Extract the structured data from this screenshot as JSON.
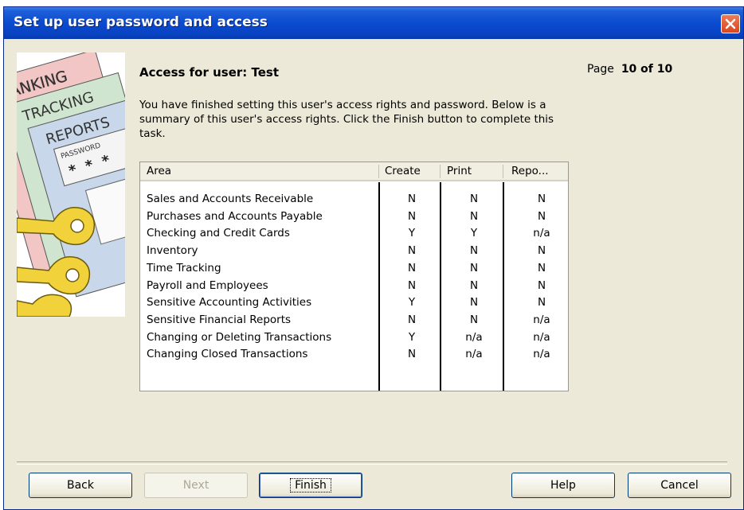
{
  "window": {
    "title": "Set up user password and access"
  },
  "heading": "Access for user: Test",
  "page": {
    "label": "Page",
    "value": "10 of 10"
  },
  "description": "You have finished setting this user's access rights and password. Below is a summary of this user's access rights.  Click the Finish button to complete this task.",
  "art": {
    "words": [
      "BANKING",
      "TRACKING",
      "REPORTS",
      "PASSWORD",
      "* * *"
    ]
  },
  "table": {
    "columns": [
      "Area",
      "Create",
      "Print",
      "Repo..."
    ],
    "rows": [
      [
        "Sales and Accounts Receivable",
        "N",
        "N",
        "N"
      ],
      [
        "Purchases and Accounts Payable",
        "N",
        "N",
        "N"
      ],
      [
        "Checking and Credit Cards",
        "Y",
        "Y",
        "n/a"
      ],
      [
        "Inventory",
        "N",
        "N",
        "N"
      ],
      [
        "Time Tracking",
        "N",
        "N",
        "N"
      ],
      [
        "Payroll and Employees",
        "N",
        "N",
        "N"
      ],
      [
        "Sensitive Accounting Activities",
        "Y",
        "N",
        "N"
      ],
      [
        "Sensitive Financial Reports",
        "N",
        "N",
        "n/a"
      ],
      [
        "Changing or Deleting Transactions",
        "Y",
        "n/a",
        "n/a"
      ],
      [
        "Changing Closed Transactions",
        "N",
        "n/a",
        "n/a"
      ]
    ]
  },
  "buttons": {
    "back": "Back",
    "next": "Next",
    "finish": "Finish",
    "help": "Help",
    "cancel": "Cancel"
  },
  "colors": {
    "titlebar": "#0a4bd0",
    "dialog_bg": "#ece9d8",
    "close": "#d8461f"
  }
}
